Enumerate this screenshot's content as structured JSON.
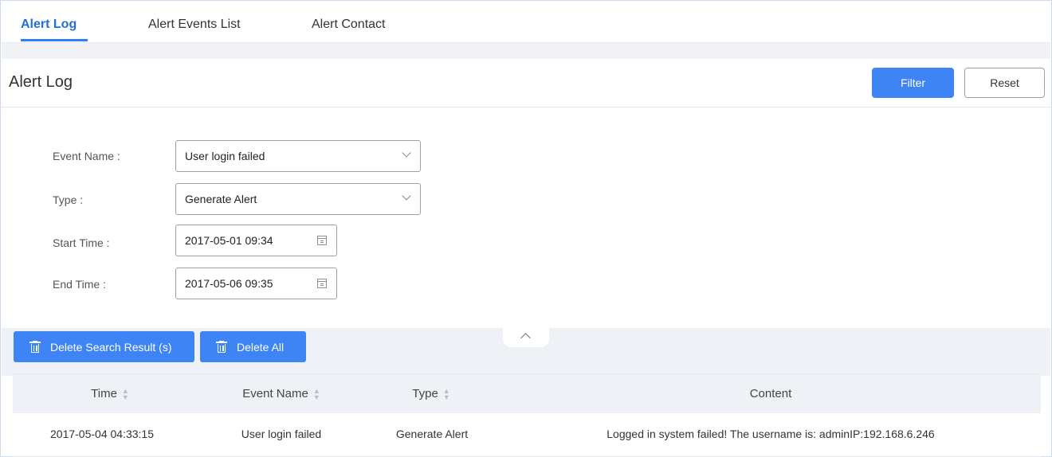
{
  "tabs": [
    {
      "label": "Alert Log",
      "active": true
    },
    {
      "label": "Alert Events List",
      "active": false
    },
    {
      "label": "Alert Contact",
      "active": false
    }
  ],
  "header": {
    "title": "Alert Log",
    "filter_label": "Filter",
    "reset_label": "Reset"
  },
  "form": {
    "event_name": {
      "label": "Event Name :",
      "value": "User login failed"
    },
    "type": {
      "label": "Type :",
      "value": "Generate Alert"
    },
    "start_time": {
      "label": "Start Time :",
      "value": "2017-05-01 09:34"
    },
    "end_time": {
      "label": "End Time :",
      "value": "2017-05-06 09:35"
    }
  },
  "actions": {
    "delete_search_label": "Delete Search Result (s)",
    "delete_all_label": "Delete All"
  },
  "table": {
    "columns": [
      "Time",
      "Event Name",
      "Type",
      "Content"
    ],
    "rows": [
      {
        "time": "2017-05-04 04:33:15",
        "event_name": "User login failed",
        "type": "Generate Alert",
        "content": "Logged in system failed! The username is: adminIP:192.168.6.246"
      }
    ]
  },
  "colors": {
    "accent": "#3e84f4",
    "active_tab": "#1f6fd6",
    "panel_bg": "#eef2f7"
  },
  "icons": [
    "chevron-down-icon",
    "calendar-icon",
    "trash-icon",
    "sort-icon",
    "chevron-up-icon"
  ]
}
